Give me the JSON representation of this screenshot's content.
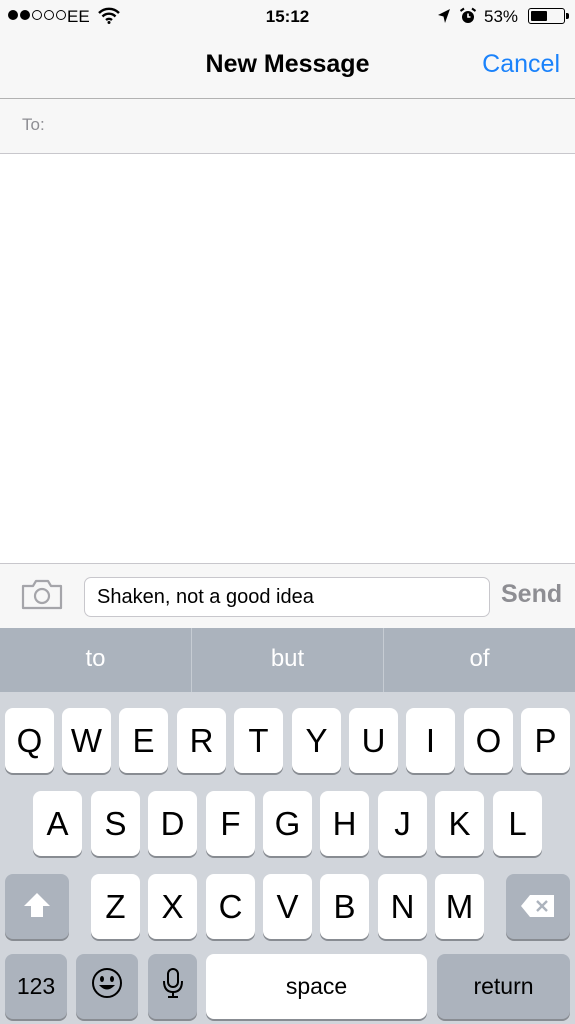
{
  "status_bar": {
    "carrier": "EE",
    "signal_bars_filled": 2,
    "signal_bars_total": 5,
    "time": "15:12",
    "battery_percent_label": "53%",
    "battery_level": 0.53
  },
  "nav": {
    "title": "New Message",
    "cancel_label": "Cancel"
  },
  "recipient": {
    "label": "To:",
    "value": ""
  },
  "compose": {
    "message_text": "Shaken, not a good idea",
    "send_label": "Send"
  },
  "predictions": [
    "to",
    "but",
    "of"
  ],
  "keyboard": {
    "row1": [
      "Q",
      "W",
      "E",
      "R",
      "T",
      "Y",
      "U",
      "I",
      "O",
      "P"
    ],
    "row2": [
      "A",
      "S",
      "D",
      "F",
      "G",
      "H",
      "J",
      "K",
      "L"
    ],
    "row3": [
      "Z",
      "X",
      "C",
      "V",
      "B",
      "N",
      "M"
    ],
    "numbers_label": "123",
    "space_label": "space",
    "return_label": "return"
  },
  "icons": {
    "wifi": "wifi-icon",
    "location": "location-arrow-icon",
    "alarm": "alarm-clock-icon",
    "battery": "battery-icon",
    "camera": "camera-icon",
    "shift": "shift-arrow-icon",
    "backspace": "backspace-icon",
    "emoji": "emoji-smiley-icon",
    "microphone": "microphone-icon"
  },
  "colors": {
    "accent": "#1a82fb",
    "keyboard_bg": "#d1d5db",
    "prediction_bar_bg": "#abb3bd",
    "send_disabled": "#8e8e93"
  }
}
